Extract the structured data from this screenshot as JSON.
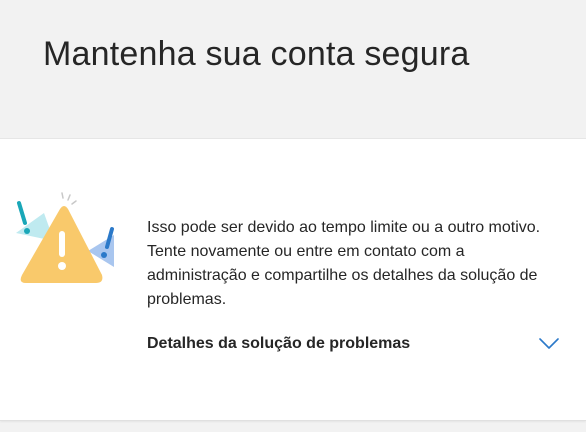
{
  "header": {
    "title": "Mantenha sua conta segura"
  },
  "card": {
    "illustration_icon": "warning-triangle-icon",
    "message": "Isso pode ser devido ao tempo limite ou a outro motivo. Tente novamente ou entre em contato com a administração e compartilhe os detalhes da solução de problemas.",
    "details_label": "Detalhes da solução de problemas",
    "details_icon": "chevron-down-icon"
  },
  "colors": {
    "header_bg": "#f2f2f2",
    "card_bg": "#ffffff",
    "text": "#262626",
    "accent": "#2b79c9",
    "warning": "#f9c96b"
  }
}
